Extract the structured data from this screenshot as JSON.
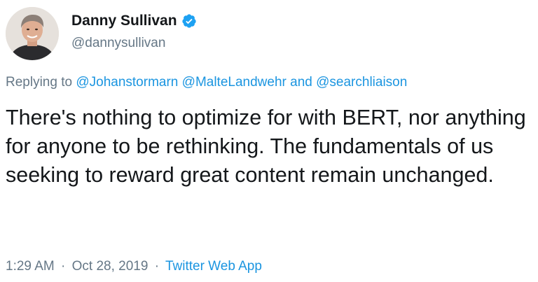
{
  "author": {
    "display_name": "Danny Sullivan",
    "handle": "@dannysullivan",
    "verified_icon": "verified-badge-icon"
  },
  "reply": {
    "prefix": "Replying to",
    "mentions": [
      "@Johanstormarn",
      "@MalteLandwehr"
    ],
    "conjunction": "and",
    "last_mention": "@searchliaison"
  },
  "tweet_text": "There's nothing to optimize for with BERT, nor anything for anyone to be rethinking. The fundamentals of us seeking to reward great content remain unchanged.",
  "meta": {
    "time": "1:29 AM",
    "separator": "·",
    "date": "Oct 28, 2019",
    "source": "Twitter Web App"
  },
  "colors": {
    "link": "#1b95e0",
    "secondary": "#657786",
    "text": "#14171a"
  }
}
